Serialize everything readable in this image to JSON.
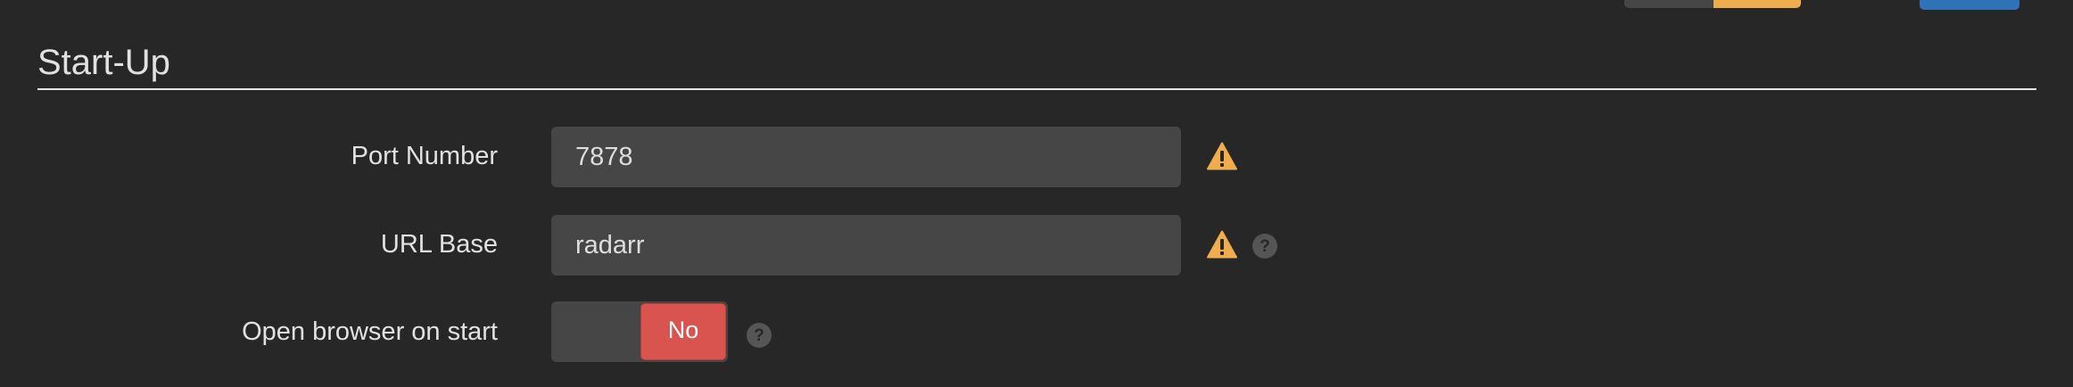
{
  "section": {
    "title": "Start-Up"
  },
  "fields": {
    "port": {
      "label": "Port Number",
      "value": "7878",
      "warning_icon": "warning-icon"
    },
    "url_base": {
      "label": "URL Base",
      "value": "radarr",
      "warning_icon": "warning-icon",
      "help_icon": "help-icon"
    },
    "open_browser": {
      "label": "Open browser on start",
      "toggle_state": "No",
      "help_icon": "help-icon"
    }
  },
  "colors": {
    "background": "#272727",
    "input_background": "#464646",
    "warning": "#f0ad4e",
    "danger": "#d9534f",
    "help_icon": "#555555",
    "primary": "#2f72b7"
  }
}
